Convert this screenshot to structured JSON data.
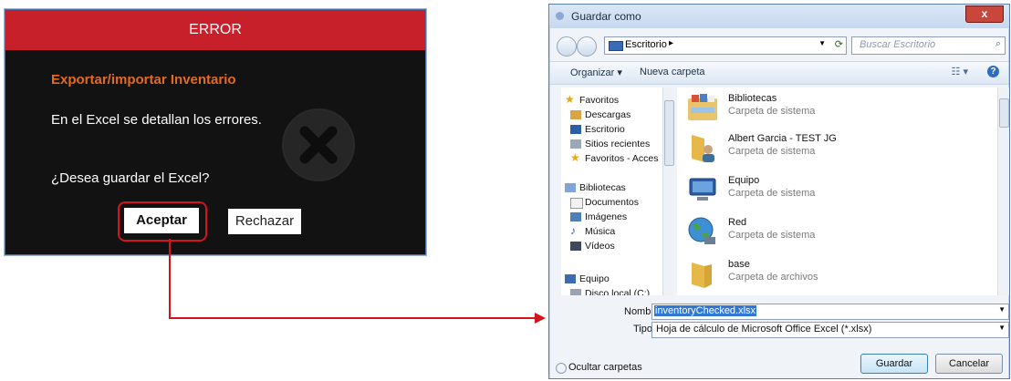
{
  "error_dialog": {
    "title": "ERROR",
    "heading": "Exportar/importar Inventario",
    "message": "En el Excel se detallan los errores.",
    "question": "¿Desea guardar el Excel?",
    "accept_label": "Aceptar",
    "reject_label": "Rechazar",
    "title_color": "#c8202a",
    "heading_color": "#e46a1e",
    "icon": "x-circle-icon"
  },
  "save_dialog": {
    "title": "Guardar como",
    "close_label": "x",
    "address": {
      "path": "Escritorio",
      "separator": "▸"
    },
    "search_placeholder": "Buscar Escritorio",
    "toolbar": {
      "organize": "Organizar ▾",
      "new_folder": "Nueva carpeta"
    },
    "nav": {
      "favorites": "Favoritos",
      "downloads": "Descargas",
      "desktop": "Escritorio",
      "recent": "Sitios recientes",
      "fav_access": "Favoritos - Acces",
      "libraries": "Bibliotecas",
      "documents": "Documentos",
      "images": "Imágenes",
      "music": "Música",
      "videos": "Vídeos",
      "computer": "Equipo",
      "disk": "Disco local (C:)"
    },
    "files": [
      {
        "name": "Bibliotecas",
        "desc": "Carpeta de sistema"
      },
      {
        "name": "Albert Garcia - TEST JG",
        "desc": "Carpeta de sistema"
      },
      {
        "name": "Equipo",
        "desc": "Carpeta de sistema"
      },
      {
        "name": "Red",
        "desc": "Carpeta de sistema"
      },
      {
        "name": "base",
        "desc": "Carpeta de archivos"
      }
    ],
    "name_label": "Nombre:",
    "name_value": "inventoryChecked.xlsx",
    "type_label": "Tipo:",
    "type_value": "Hoja de cálculo de Microsoft Office Excel (*.xlsx)",
    "hide_folders": "Ocultar carpetas",
    "save_label": "Guardar",
    "cancel_label": "Cancelar"
  },
  "connector_color": "#d4141c"
}
